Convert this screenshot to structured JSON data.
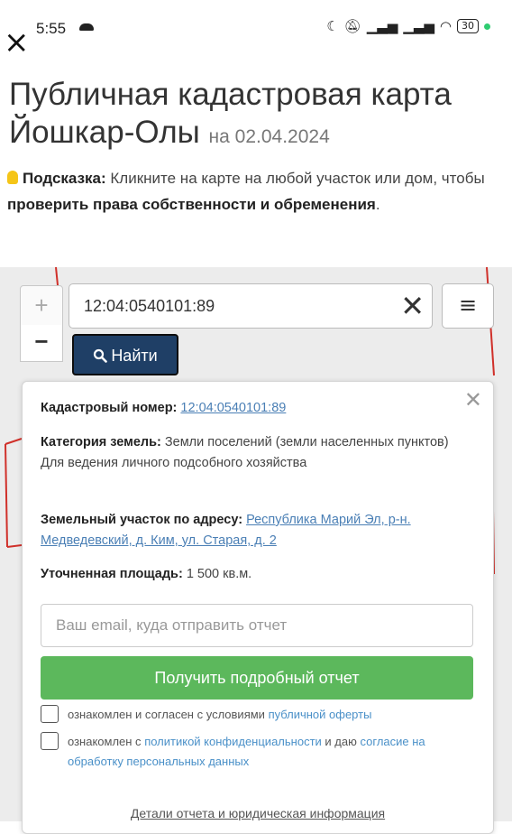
{
  "status_bar": {
    "time": "5:55",
    "icons": [
      "moon-icon",
      "mute-icon",
      "signal-icon",
      "signal-icon",
      "wifi-icon"
    ],
    "battery": "30"
  },
  "close_symbol": "×",
  "header": {
    "title_line1": "Публичная кадастровая карта",
    "title_line2": "Йошкар-Олы",
    "date_prefix": "на",
    "date": "02.04.2024"
  },
  "hint": {
    "label": "Подсказка:",
    "text1": "Кликните на карте на любой участок или дом, чтобы",
    "bold": "проверить права собственности и обременения",
    "text2": "."
  },
  "map": {
    "zoom_in": "+",
    "zoom_out": "−",
    "search_value": "12:04:0540101:89",
    "clear_symbol": "✕",
    "menu_symbol": "≡",
    "find_label": "Найти"
  },
  "popup": {
    "close_symbol": "✕",
    "cadastral_label": "Кадастровый номер:",
    "cadastral_value": "12:04:0540101:89",
    "category_label": "Категория земель:",
    "category_value": "Земли поселений (земли населенных пунктов)",
    "usage": "Для ведения личного подсобного хозяйства",
    "address_label": "Земельный участок по адресу:",
    "address_value": "Республика Марий Эл, р-н. Медведевский, д. Ким, ул. Старая, д. 2",
    "area_label": "Уточненная площадь:",
    "area_value": "1 500 кв.м.",
    "email_placeholder": "Ваш email, куда отправить отчет",
    "report_button": "Получить подробный отчет",
    "consent1_text": "ознакомлен и согласен с условиями",
    "consent1_link": "публичной оферты",
    "consent2_text1": "ознакомлен с",
    "consent2_link1": "политикой конфиденциальности",
    "consent2_text2": "и даю",
    "consent2_link2": "согласие на обработку персональных данных",
    "footer_link": "Детали отчета и юридическая информация"
  },
  "colors": {
    "find_button": "#1f3f66",
    "report_button": "#5cb85c",
    "link": "#4a7fb5",
    "map_line": "#d0302a"
  }
}
